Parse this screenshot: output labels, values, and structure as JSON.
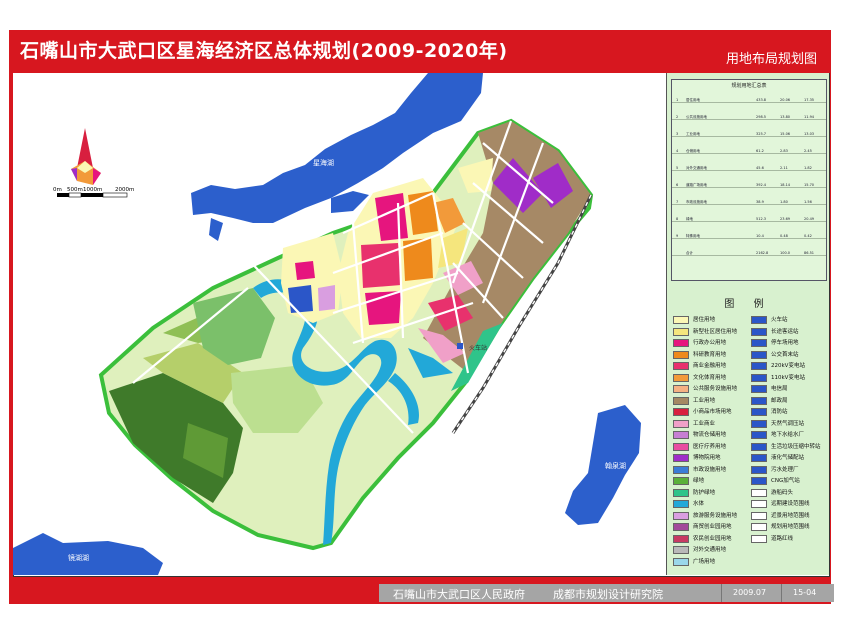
{
  "header": {
    "title": "石嘴山市大武口区星海经济区总体规划(2009-2020年)",
    "subtitle": "用地布局规划图"
  },
  "map": {
    "scale_labels": [
      "0m",
      "500m",
      "1000m",
      "2000m"
    ],
    "place_labels": {
      "lake_north": "星海湖",
      "lake_southeast": "翰泉湖",
      "lake_southwest": "镜湖湖",
      "station": "火车站"
    }
  },
  "table": {
    "title": "规划用地汇总表",
    "rows": [
      {
        "code": "1",
        "name": "居住用地",
        "area": "433.8",
        "pct": "20.06",
        "per": "17.35"
      },
      {
        "code": "2",
        "name": "公共设施用地",
        "area": "298.5",
        "pct": "13.80",
        "per": "11.94"
      },
      {
        "code": "3",
        "name": "工业用地",
        "area": "325.7",
        "pct": "15.06",
        "per": "13.03"
      },
      {
        "code": "4",
        "name": "仓储用地",
        "area": "61.2",
        "pct": "2.83",
        "per": "2.45"
      },
      {
        "code": "5",
        "name": "对外交通用地",
        "area": "45.6",
        "pct": "2.11",
        "per": "1.82"
      },
      {
        "code": "6",
        "name": "道路广场用地",
        "area": "392.4",
        "pct": "18.14",
        "per": "15.70"
      },
      {
        "code": "7",
        "name": "市政设施用地",
        "area": "38.9",
        "pct": "1.80",
        "per": "1.56"
      },
      {
        "code": "8",
        "name": "绿地",
        "area": "512.3",
        "pct": "23.69",
        "per": "20.49"
      },
      {
        "code": "9",
        "name": "特殊用地",
        "area": "10.4",
        "pct": "0.48",
        "per": "0.42"
      },
      {
        "code": "",
        "name": "合计",
        "area": "2162.8",
        "pct": "100.0",
        "per": "86.51"
      }
    ]
  },
  "legend": {
    "title": "图 例",
    "left": [
      {
        "label": "居住用地",
        "color": "#fbf7b5"
      },
      {
        "label": "新型社区居住用地",
        "color": "#f5e67d"
      },
      {
        "label": "行政办公用地",
        "color": "#e6157e"
      },
      {
        "label": "科研教育用地",
        "color": "#ee8a1c"
      },
      {
        "label": "商业金融用地",
        "color": "#e8316d"
      },
      {
        "label": "文化体育用地",
        "color": "#f29a3a"
      },
      {
        "label": "公共服务设施用地",
        "color": "#f5b183"
      },
      {
        "label": "工业用地",
        "color": "#a48863"
      },
      {
        "label": "小商品市场用地",
        "color": "#d81f3f"
      },
      {
        "label": "工业商业",
        "color": "#f0a0c8"
      },
      {
        "label": "物流仓储用地",
        "color": "#c67fd3"
      },
      {
        "label": "医疗疗养用地",
        "color": "#e84ea0"
      },
      {
        "label": "博物院用地",
        "color": "#9f2dc8"
      },
      {
        "label": "市政设施用地",
        "color": "#3a7cd6"
      },
      {
        "label": "绿地",
        "color": "#5ab03a"
      },
      {
        "label": "防护绿地",
        "color": "#2fc48a"
      },
      {
        "label": "水体",
        "color": "#22a8d8"
      },
      {
        "label": "旅游服务设施用地",
        "color": "#d99ee0"
      },
      {
        "label": "商贸创业园用地",
        "color": "#a24a9a"
      },
      {
        "label": "农民创业园用地",
        "color": "#c73a62"
      },
      {
        "label": "对外交通用地",
        "color": "#b9b9b9"
      },
      {
        "label": "广场用地",
        "color": "#9ad7ea"
      }
    ],
    "right": [
      {
        "label": "火车站",
        "color": "#2b56c8"
      },
      {
        "label": "长途客运站",
        "color": "#2b56c8"
      },
      {
        "label": "停车场用地",
        "color": "#2b56c8"
      },
      {
        "label": "公交首末站",
        "color": "#2b56c8"
      },
      {
        "label": "220kV变电站",
        "color": "#2b56c8"
      },
      {
        "label": "110kV变电站",
        "color": "#2b56c8"
      },
      {
        "label": "电信局",
        "color": "#2b56c8"
      },
      {
        "label": "邮政局",
        "color": "#2b56c8"
      },
      {
        "label": "消防站",
        "color": "#2b56c8"
      },
      {
        "label": "天然气调压站",
        "color": "#2b56c8"
      },
      {
        "label": "地下水给水厂",
        "color": "#2b56c8"
      },
      {
        "label": "生活垃圾压缩中转站",
        "color": "#2b56c8"
      },
      {
        "label": "液化气储配站",
        "color": "#2b56c8"
      },
      {
        "label": "污水处理厂",
        "color": "#2b56c8"
      },
      {
        "label": "CNG加气站",
        "color": "#2b56c8"
      },
      {
        "label": "游船码头",
        "color": "#ffffff"
      },
      {
        "label": "远期建设范围线",
        "color": "#ffffff"
      },
      {
        "label": "近景用地范围线",
        "color": "#ffffff"
      },
      {
        "label": "规划用地范围线",
        "color": "#ffffff"
      },
      {
        "label": "道路红线",
        "color": "#ffffff"
      }
    ]
  },
  "footer": {
    "government": "石嘴山市大武口区人民政府",
    "institute": "成都市规划设计研究院",
    "date": "2009.07",
    "sheet": "15-04"
  }
}
